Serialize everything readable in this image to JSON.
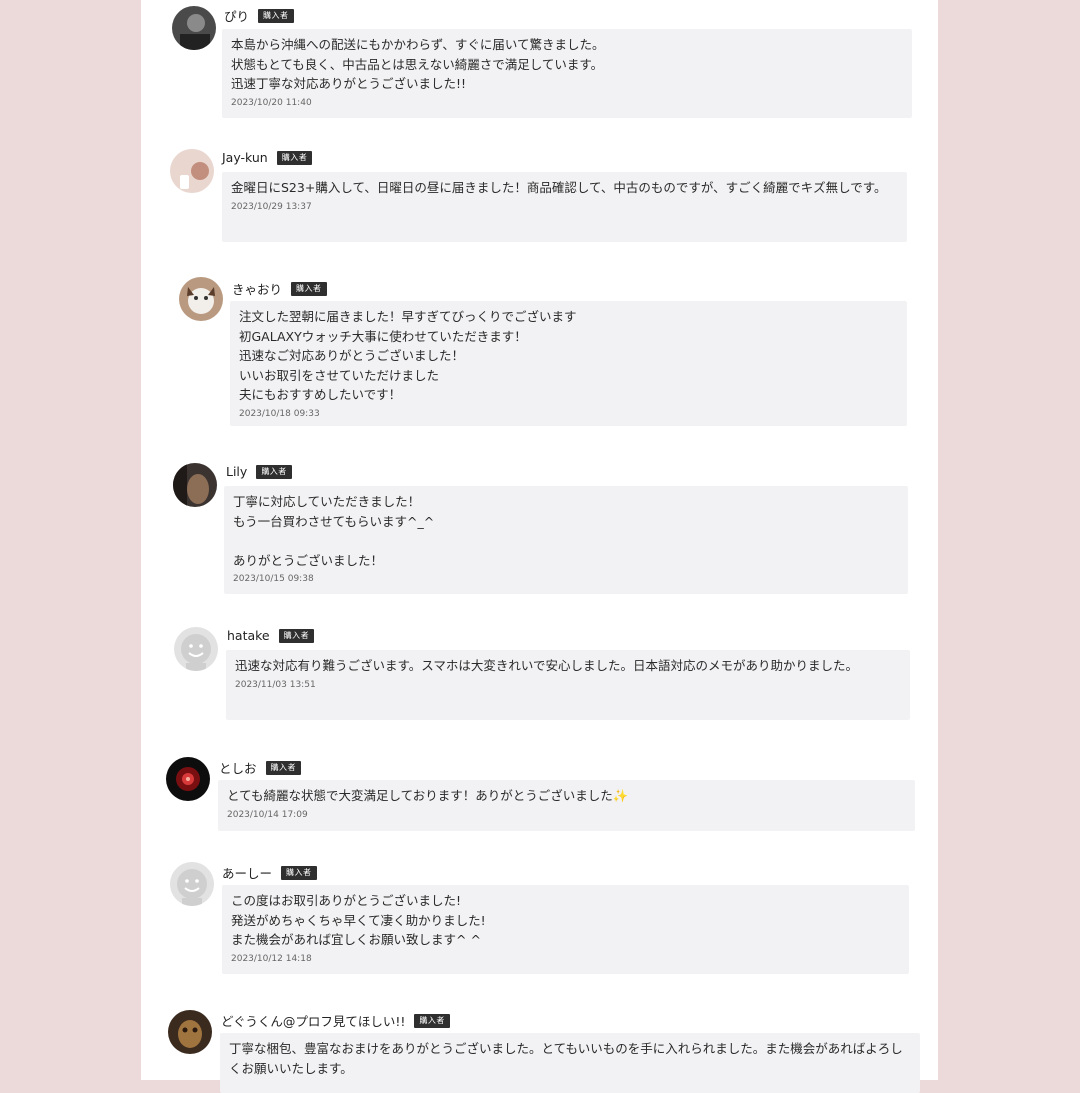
{
  "badge_label": "購入者",
  "reviews": [
    {
      "name": "ぴり",
      "message": "本島から沖縄への配送にもかかわらず、すぐに届いて驚きました。\n状態もとても良く、中古品とは思えない綺麗さで満足しています。\n迅速丁寧な対応ありがとうございました!!",
      "timestamp": "2023/10/20 11:40",
      "avatar": "dark-photo-avatar"
    },
    {
      "name": "Jay-kun",
      "message": "金曜日にS23+購入して、日曜日の昼に届きました！商品確認して、中古のものですが、すごく綺麗でキズ無しです。",
      "timestamp": "2023/10/29 13:37",
      "avatar": "beige-photo-avatar"
    },
    {
      "name": "きゃおり",
      "message": "注文した翌朝に届きました！早すぎてびっくりでございます\n初GALAXYウォッチ大事に使わせていただきます！\n迅速なご対応ありがとうございました！\nいいお取引をさせていただけました\n夫にもおすすめしたいです！",
      "timestamp": "2023/10/18 09:33",
      "avatar": "cat-photo-avatar"
    },
    {
      "name": "Lily",
      "message": "丁寧に対応していただきました！\nもう一台買わさせてもらいます^_^\n\nありがとうございました！",
      "timestamp": "2023/10/15 09:38",
      "avatar": "brown-photo-avatar"
    },
    {
      "name": "hatake",
      "message": "迅速な対応有り難うございます。スマホは大変きれいで安心しました。日本語対応のメモがあり助かりました。",
      "timestamp": "2023/11/03 13:51",
      "avatar": "default-user-avatar"
    },
    {
      "name": "としお",
      "message": "とても綺麗な状態で大変満足しております！ありがとうございました",
      "emoji": "✨",
      "timestamp": "2023/10/14 17:09",
      "avatar": "red-photo-avatar"
    },
    {
      "name": "あーしー",
      "message": "この度はお取引ありがとうございました!\n発送がめちゃくちゃ早くて凄く助かりました!\nまた機会があれば宜しくお願い致します^ ^",
      "timestamp": "2023/10/12 14:18",
      "avatar": "default-user-avatar"
    },
    {
      "name": "どぐうくん@プロフ見てほしい!!",
      "message": "丁寧な梱包、豊富なおまけをありがとうございました。とてもいいものを手に入れられました。また機会があればよろしくお願いいたします。",
      "timestamp": "",
      "avatar": "dogu-photo-avatar"
    }
  ]
}
